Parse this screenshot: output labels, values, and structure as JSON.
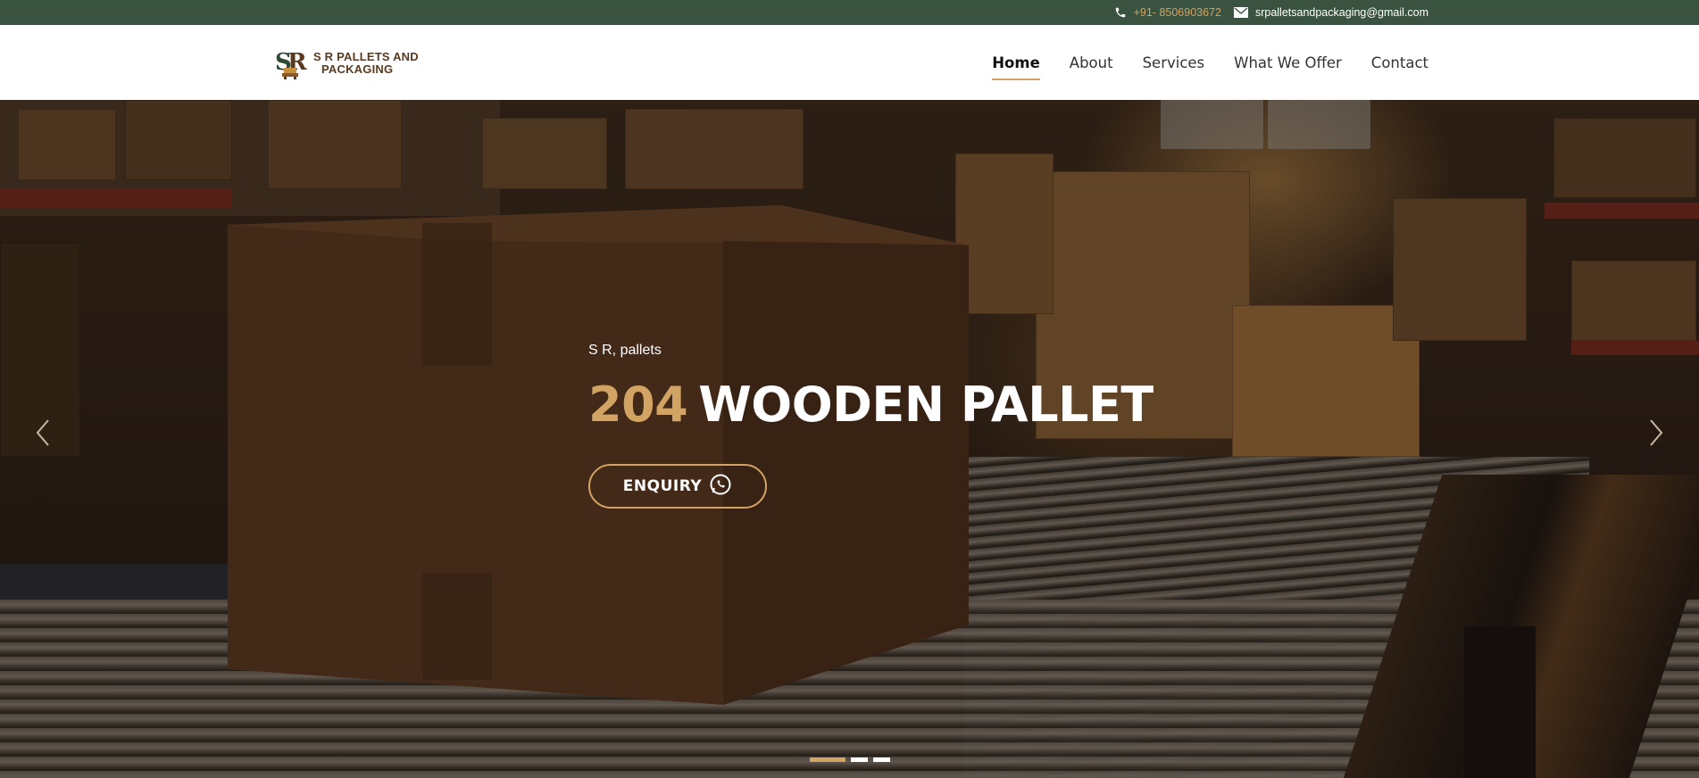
{
  "topbar": {
    "phone": "+91- 8506903672",
    "email": "srpalletsandpackaging@gmail.com",
    "phone_icon": "phone-icon",
    "email_icon": "mail-icon"
  },
  "brand": {
    "logo_mark": "SR",
    "line1": "S R PALLETS AND",
    "line2": "PACKAGING"
  },
  "nav": {
    "items": [
      {
        "label": "Home",
        "active": true
      },
      {
        "label": "About"
      },
      {
        "label": "Services"
      },
      {
        "label": "What We Offer"
      },
      {
        "label": "Contact"
      }
    ]
  },
  "hero": {
    "subtitle": "S R, pallets",
    "headline_number": "204",
    "headline_text": "WOODEN PALLET",
    "cta_label": "ENQUIRY",
    "cta_icon": "whatsapp-icon",
    "prev_icon": "chevron-left-icon",
    "next_icon": "chevron-right-icon",
    "slides_total": 3,
    "active_slide": 1
  },
  "colors": {
    "topbar_bg": "#3a5240",
    "accent": "#d2a463",
    "header_bg": "#ffffff",
    "brand_text": "#5a3a1e"
  }
}
